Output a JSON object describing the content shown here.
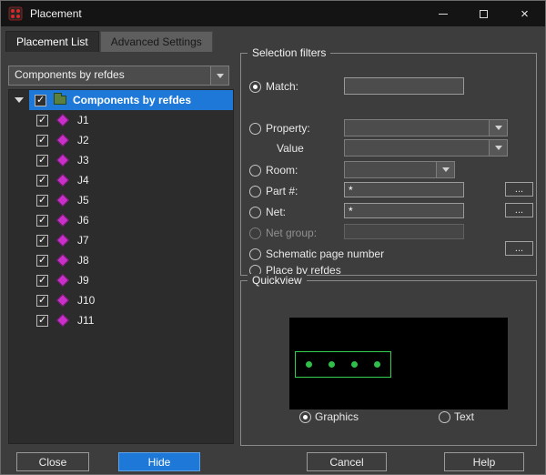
{
  "window": {
    "title": "Placement",
    "close_glyph": "×"
  },
  "tabs": {
    "placement_list": "Placement List",
    "advanced_settings": "Advanced Settings"
  },
  "left_panel": {
    "list_mode_dropdown": {
      "value": "Components by refdes"
    },
    "tree": {
      "root": {
        "label": "Components by refdes",
        "checked": true,
        "expanded": true,
        "selected": true
      },
      "items": [
        {
          "label": "J1",
          "checked": true
        },
        {
          "label": "J2",
          "checked": true
        },
        {
          "label": "J3",
          "checked": true
        },
        {
          "label": "J4",
          "checked": true
        },
        {
          "label": "J5",
          "checked": true
        },
        {
          "label": "J6",
          "checked": true
        },
        {
          "label": "J7",
          "checked": true
        },
        {
          "label": "J8",
          "checked": true
        },
        {
          "label": "J9",
          "checked": true
        },
        {
          "label": "J10",
          "checked": true
        },
        {
          "label": "J11",
          "checked": true
        }
      ]
    },
    "close_button": "Close",
    "hide_button": "Hide"
  },
  "selection_filters": {
    "title": "Selection filters",
    "match_label": "Match:",
    "match_value": "",
    "match_selected": true,
    "property_label": "Property:",
    "value_label": "Value",
    "room_label": "Room:",
    "part_label": "Part #:",
    "part_value": "*",
    "net_label": "Net:",
    "net_value": "*",
    "net_group_label": "Net group:",
    "net_group_value": "",
    "net_group_disabled": true,
    "schematic_label": "Schematic page number",
    "place_by_refdes_label": "Place by refdes",
    "browse_label": "..."
  },
  "quickview": {
    "title": "Quickview",
    "graphics_label": "Graphics",
    "text_label": "Text",
    "graphics_selected": true,
    "pin_count": 4
  },
  "footer": {
    "cancel_button": "Cancel",
    "help_button": "Help"
  },
  "colors": {
    "selection_blue": "#1e78d7",
    "preview_green": "#2fbf4a",
    "component_magenta": "#c92fc9",
    "window_bg": "#3d3d3d",
    "titlebar_bg": "#141414",
    "tree_bg": "#2c2c2c"
  }
}
